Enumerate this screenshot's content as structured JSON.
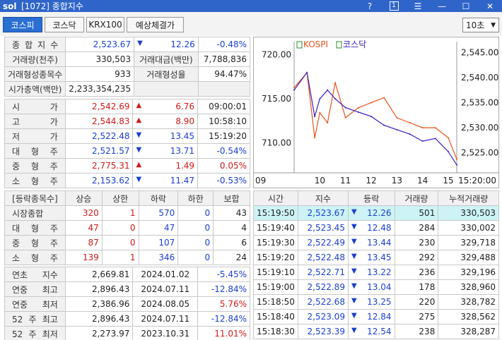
{
  "window": {
    "logo": "sol",
    "title": "[1072] 종합지수",
    "help": "?",
    "num": "1",
    "menu": "☰",
    "min": "—",
    "max": "☐",
    "close": "✕"
  },
  "tabs": [
    {
      "label": "코스피",
      "active": true
    },
    {
      "label": "코스닥",
      "active": false
    },
    {
      "label": "KRX100",
      "active": false
    },
    {
      "label": "예상체결가",
      "active": false
    }
  ],
  "interval": {
    "value": "10초"
  },
  "summary": {
    "composite_label": "종 합 지 수",
    "composite_value": "2,523.67",
    "composite_change": "12.26",
    "composite_rate": "-0.48%",
    "volume_label": "거래량(천주)",
    "volume_value": "330,503",
    "amount_label": "거래대금(백만)",
    "amount_value": "7,788,836",
    "formed_label": "거래형성종목수",
    "formed_value": "933",
    "formed_rate_label": "거래형성율",
    "formed_rate_value": "94.47%",
    "cap_label": "시가총액(백만)",
    "cap_value": "2,233,354,235"
  },
  "ohlc": [
    {
      "label": "시 가",
      "value": "2,542.69",
      "dir": "up",
      "change": "6.76",
      "extra": "09:00:01"
    },
    {
      "label": "고 가",
      "value": "2,544.83",
      "dir": "up",
      "change": "8.90",
      "extra": "10:58:10"
    },
    {
      "label": "저 가",
      "value": "2,522.48",
      "dir": "dn",
      "change": "13.45",
      "extra": "15:19:20"
    },
    {
      "label": "대 형 주",
      "value": "2,521.57",
      "dir": "dn",
      "change": "13.71",
      "extra": "-0.54%"
    },
    {
      "label": "중 형 주",
      "value": "2,775.31",
      "dir": "up",
      "change": "1.49",
      "extra": "0.05%"
    },
    {
      "label": "소 형 주",
      "value": "2,153.62",
      "dir": "dn",
      "change": "11.47",
      "extra": "-0.53%"
    }
  ],
  "breadth": {
    "headers": [
      "[등락종목수]",
      "상승",
      "상한",
      "하락",
      "하한",
      "보합"
    ],
    "rows": [
      [
        "시장종합",
        "320",
        "1",
        "570",
        "0",
        "43"
      ],
      [
        "대 형 주",
        "47",
        "0",
        "47",
        "0",
        "4"
      ],
      [
        "중 형 주",
        "87",
        "0",
        "107",
        "0",
        "6"
      ],
      [
        "소 형 주",
        "139",
        "1",
        "346",
        "0",
        "24"
      ]
    ]
  },
  "annual": [
    {
      "label": "연초 지수",
      "value": "2,669.81",
      "date": "2024.01.02",
      "rate": "-5.45%",
      "dir": "dn"
    },
    {
      "label": "연중 최고",
      "value": "2,896.43",
      "date": "2024.07.11",
      "rate": "-12.84%",
      "dir": "dn"
    },
    {
      "label": "연중 최저",
      "value": "2,386.96",
      "date": "2024.08.05",
      "rate": "5.76%",
      "dir": "up"
    },
    {
      "label": "52 주 최고",
      "value": "2,896.43",
      "date": "2024.07.11",
      "rate": "-12.84%",
      "dir": "dn"
    },
    {
      "label": "52 주 최저",
      "value": "2,273.97",
      "date": "2023.10.31",
      "rate": "11.01%",
      "dir": "up"
    }
  ],
  "ticks": {
    "headers": [
      "시간",
      "지수",
      "등락",
      "거래량",
      "누적거래량"
    ],
    "rows": [
      [
        "15:19:50",
        "2,523.67",
        "12.26",
        "501",
        "330,503"
      ],
      [
        "15:19:40",
        "2,523.45",
        "12.48",
        "284",
        "330,002"
      ],
      [
        "15:19:30",
        "2,522.49",
        "13.44",
        "230",
        "329,718"
      ],
      [
        "15:19:20",
        "2,522.48",
        "13.45",
        "292",
        "329,488"
      ],
      [
        "15:19:10",
        "2,522.71",
        "13.22",
        "236",
        "329,196"
      ],
      [
        "15:19:00",
        "2,522.89",
        "13.04",
        "178",
        "328,960"
      ],
      [
        "15:18:50",
        "2,522.68",
        "13.25",
        "220",
        "328,782"
      ],
      [
        "15:18:40",
        "2,523.09",
        "12.84",
        "275",
        "328,562"
      ],
      [
        "15:18:30",
        "2,523.39",
        "12.54",
        "238",
        "328,287"
      ]
    ]
  },
  "chart_data": {
    "type": "line",
    "legend": [
      "KOSPI",
      "코스닥"
    ],
    "left_ticks": [
      "720.00",
      "715.00",
      "710.00"
    ],
    "right_ticks": [
      "2,545.00",
      "2,540.00",
      "2,535.00",
      "2,530.00",
      "2,525.00"
    ],
    "x_ticks": [
      "09",
      "10",
      "11",
      "12",
      "13",
      "14",
      "15",
      "15:20:00"
    ],
    "left_ylim": [
      706.6,
      721.5
    ],
    "right_ylim": [
      2521.0,
      2547.2
    ],
    "series": [
      {
        "name": "KOSPI",
        "axis": "right",
        "color": "#e8521c",
        "x": [
          9.0,
          9.5,
          9.8,
          10.0,
          10.3,
          10.6,
          11.0,
          11.5,
          12.0,
          12.5,
          13.0,
          13.5,
          14.0,
          14.5,
          15.0,
          15.33
        ],
        "y": [
          2538,
          2541,
          2528,
          2533,
          2531,
          2539,
          2532,
          2534,
          2535,
          2536,
          2532,
          2531,
          2530,
          2530,
          2528,
          2523.7
        ]
      },
      {
        "name": "코스닥",
        "axis": "left",
        "color": "#3a1fbf",
        "x": [
          9.0,
          9.5,
          9.8,
          10.0,
          10.3,
          10.6,
          11.0,
          11.5,
          12.0,
          12.5,
          13.0,
          13.5,
          14.0,
          14.5,
          15.0,
          15.33
        ],
        "y": [
          716,
          718,
          713,
          715,
          716,
          715,
          714,
          713.5,
          713,
          712,
          711.5,
          711,
          710.2,
          710.5,
          709,
          707.5
        ]
      }
    ]
  },
  "colors": {
    "titlebar": "#2f65c9",
    "up": "#d21a1a",
    "down": "#1a3fd2",
    "highlight": "#cdf3f6"
  }
}
